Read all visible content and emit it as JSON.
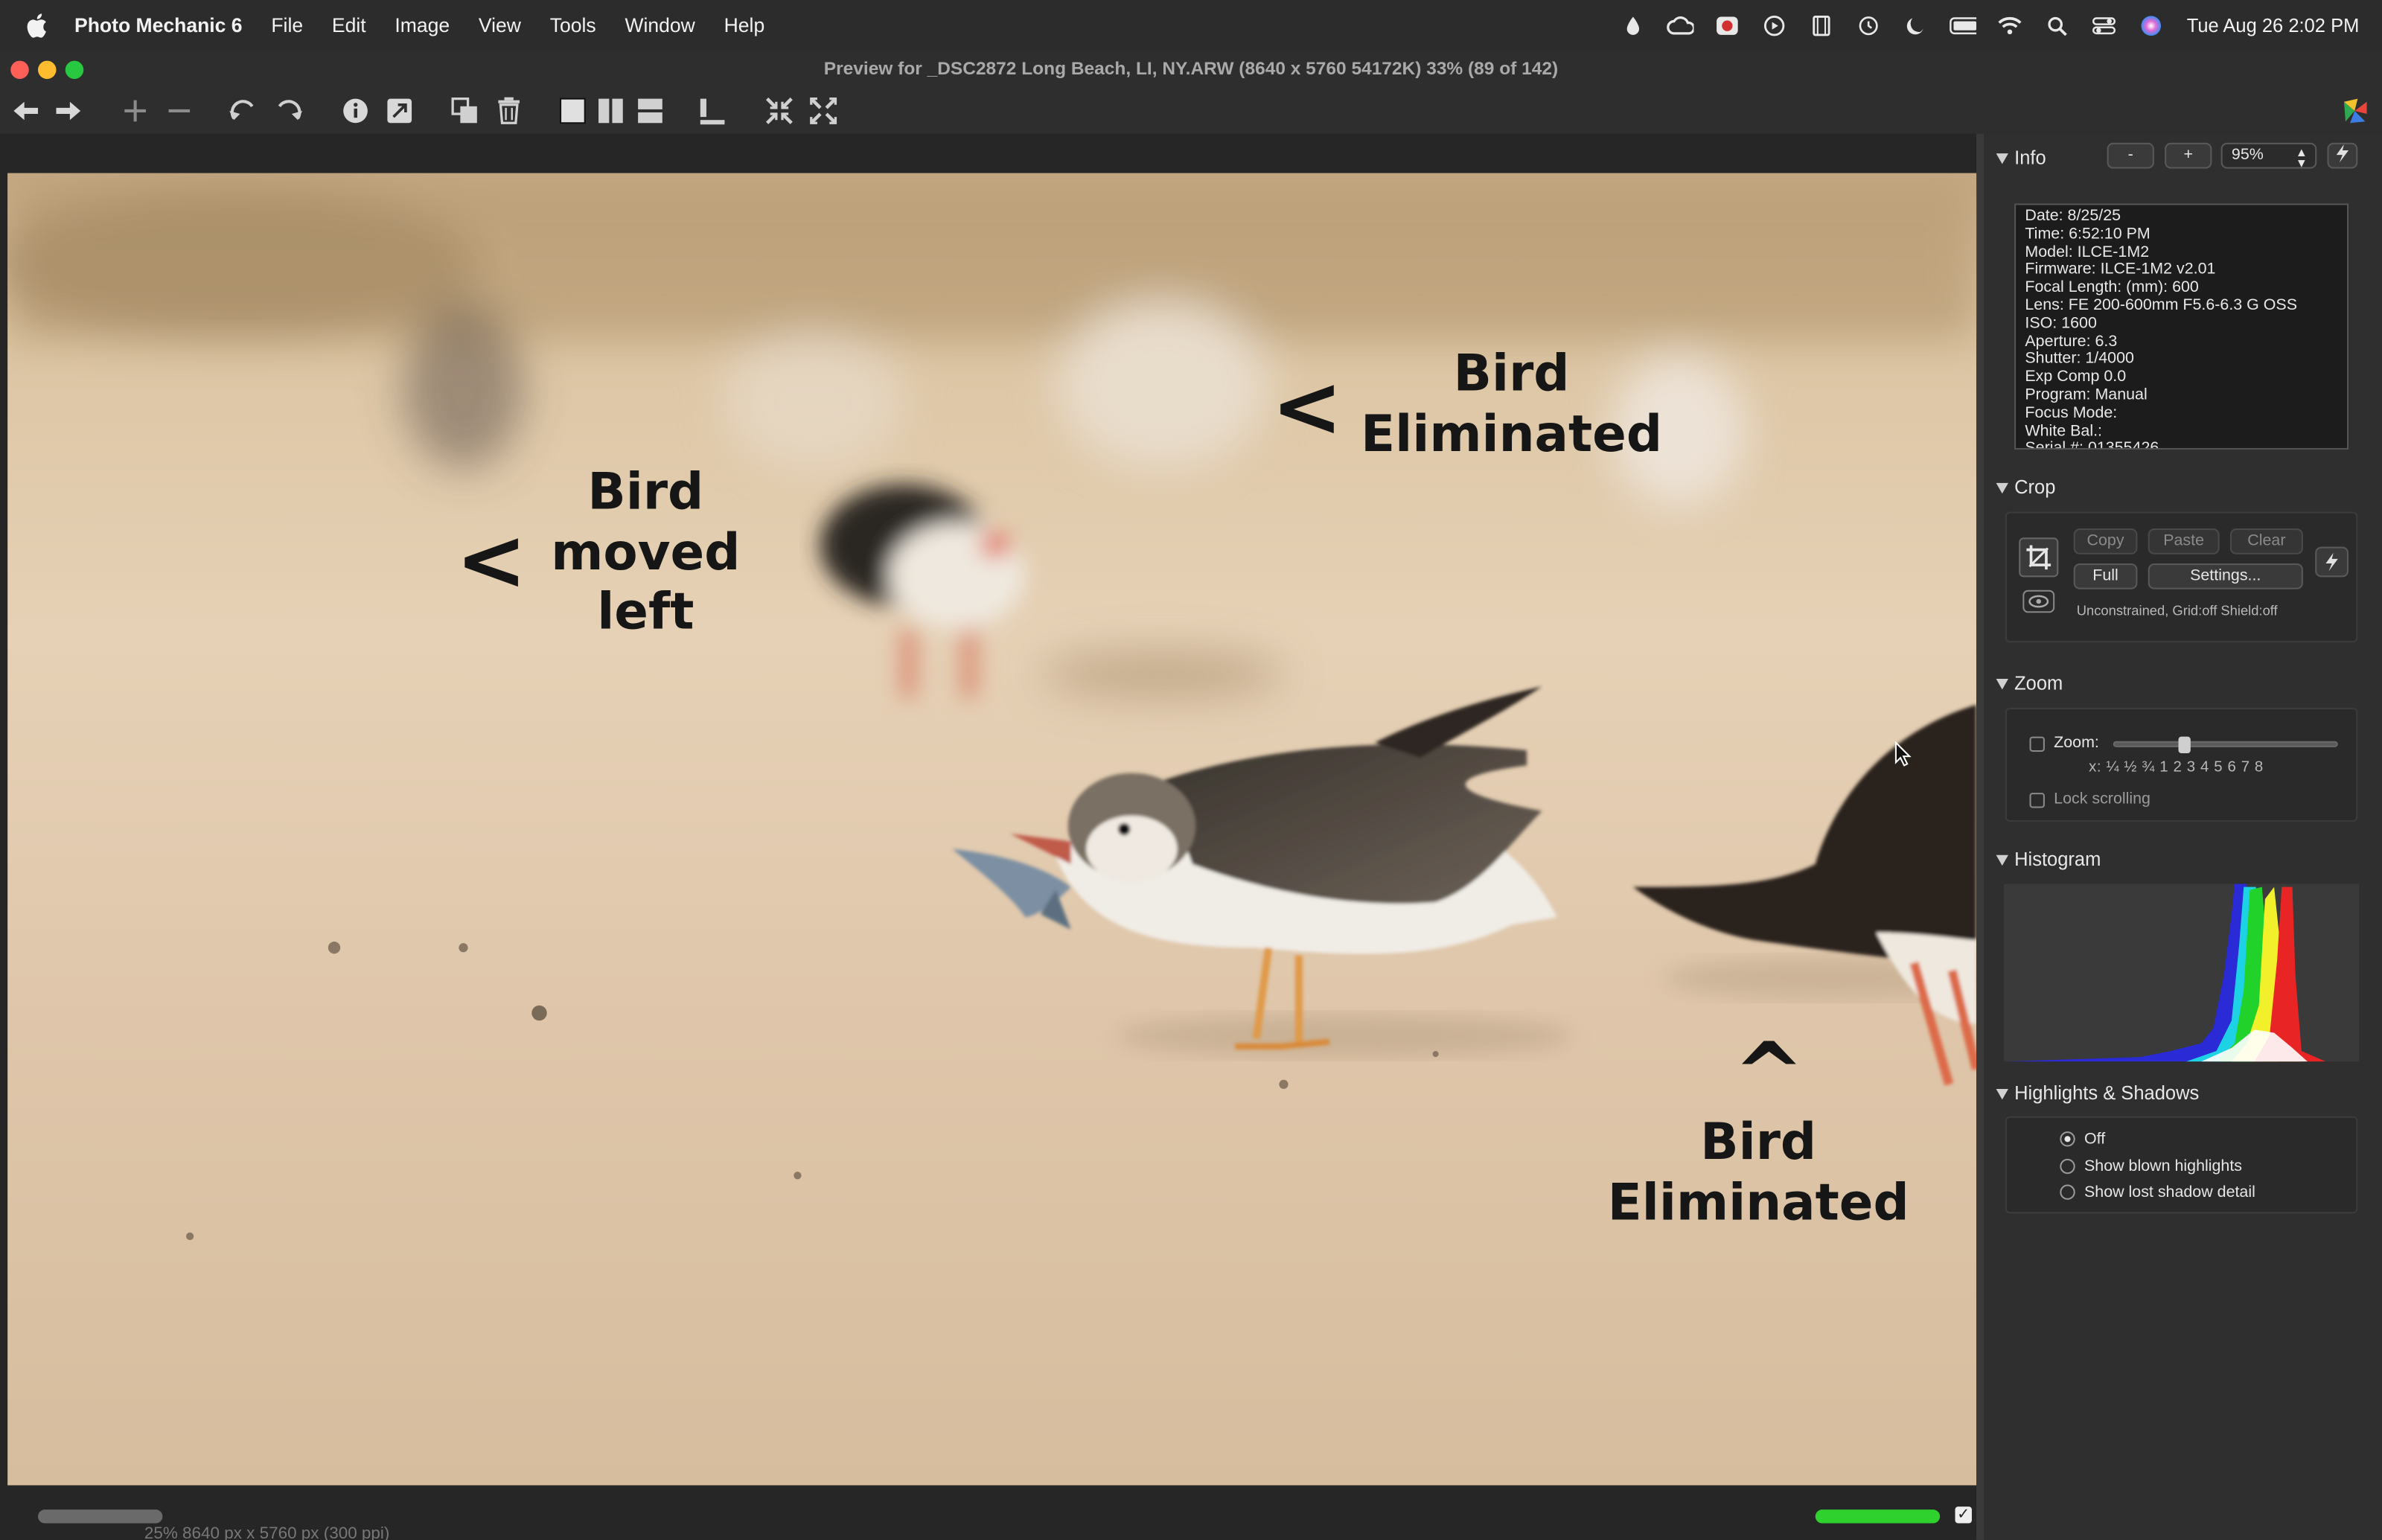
{
  "menubar": {
    "app_name": "Photo Mechanic 6",
    "items": [
      "File",
      "Edit",
      "Image",
      "View",
      "Tools",
      "Window",
      "Help"
    ],
    "clock": "Tue Aug 26  2:02 PM"
  },
  "window": {
    "title": "Preview for  _DSC2872 Long Beach, LI, NY.ARW (8640 x 5760 54172K) 33% (89 of 142)"
  },
  "photo": {
    "annotations": {
      "moved": [
        "Bird",
        "moved",
        "left"
      ],
      "elim_top": [
        "Bird",
        "Eliminated"
      ],
      "elim_bottom": [
        "Bird",
        "Eliminated"
      ],
      "arrow_left": "<",
      "arrow_up": "^"
    }
  },
  "status": {
    "dimensions": "25%     8640 px x 5760 px (300 ppi)",
    "checkbox_mark": "✓"
  },
  "panel": {
    "info": {
      "title": "Info",
      "minus_label": "-",
      "plus_label": "+",
      "zoom_value": "95%",
      "lines": [
        "Date: 8/25/25",
        "Time: 6:52:10 PM",
        "Model: ILCE-1M2",
        "Firmware: ILCE-1M2 v2.01",
        "Focal Length:  (mm): 600",
        "Lens: FE 200-600mm F5.6-6.3 G OSS",
        "ISO: 1600",
        "Aperture: 6.3",
        "Shutter: 1/4000",
        "Exp Comp 0.0",
        "Program: Manual",
        "Focus Mode:",
        "White Bal.:",
        "Serial #: 01355426"
      ]
    },
    "crop": {
      "title": "Crop",
      "copy": "Copy",
      "paste": "Paste",
      "clear": "Clear",
      "full": "Full",
      "settings": "Settings...",
      "status": "Unconstrained, Grid:off Shield:off"
    },
    "zoom": {
      "title": "Zoom",
      "label": "Zoom:",
      "ticks": "x:  ¼  ½  ¾  1   2   3   4   5   6   7   8",
      "lock": "Lock scrolling",
      "level": 1
    },
    "histogram": {
      "title": "Histogram"
    },
    "highlights": {
      "title": "Highlights & Shadows",
      "options": [
        "Off",
        "Show blown highlights",
        "Show lost shadow detail"
      ],
      "selected": "Off"
    }
  },
  "colors": {
    "progress": "#2fd12f",
    "close": "#fe5f57",
    "minimize": "#febc2e",
    "maximize": "#28c840"
  }
}
